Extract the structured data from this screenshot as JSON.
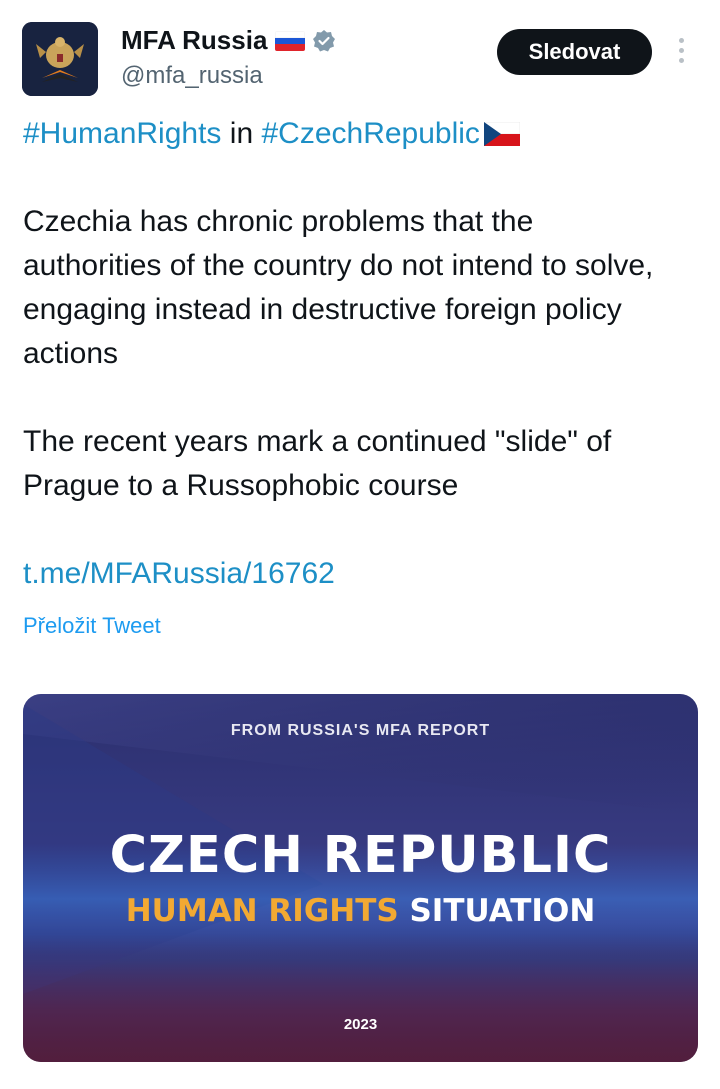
{
  "author": {
    "name": "MFA Russia",
    "handle": "@mfa_russia",
    "follow_label": "Sledovat"
  },
  "icons": {
    "avatar": "russian-coat-of-arms",
    "name_flag": "russia-flag",
    "verified": "verified-badge",
    "menu": "more-vertical",
    "inline_flag": "czech-flag"
  },
  "tweet": {
    "hashtag1": "#HumanRights",
    "in_word": " in ",
    "hashtag2": "#CzechRepublic",
    "paragraph1": "Czechia has chronic problems that the authorities of the country do not intend to solve, engaging instead in destructive foreign policy actions",
    "paragraph2": "The recent years mark a continued \"slide\" of Prague to a Russophobic course",
    "link": "t.me/MFARussia/16762"
  },
  "translate_label": "Přeložit Tweet",
  "media": {
    "top_label": "FROM RUSSIA'S MFA REPORT",
    "title": "CZECH REPUBLIC",
    "subtitle_highlight": "HUMAN RIGHTS",
    "subtitle_rest": " SITUATION",
    "year": "2023"
  },
  "colors": {
    "link": "#1d8fc6",
    "follow_bg": "#0f1419",
    "accent_orange": "#f2a933"
  }
}
